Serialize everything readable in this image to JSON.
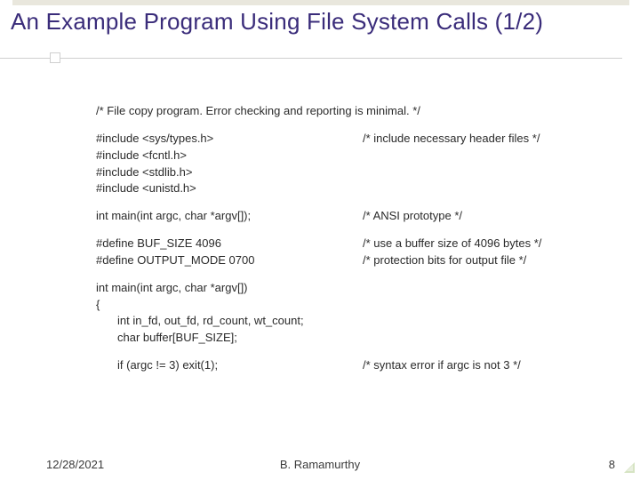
{
  "slide": {
    "title": "An Example Program Using File System Calls (1/2)"
  },
  "code": {
    "r0l": "/* File copy program. Error checking and reporting is minimal. */",
    "r1l": "#include <sys/types.h>",
    "r1r": "/* include necessary header files */",
    "r2l": "#include <fcntl.h>",
    "r3l": "#include <stdlib.h>",
    "r4l": "#include <unistd.h>",
    "r5l": "int main(int argc, char *argv[]);",
    "r5r": "/* ANSI prototype */",
    "r6l": "#define BUF_SIZE 4096",
    "r6r": "/* use a buffer size of 4096 bytes */",
    "r7l": "#define OUTPUT_MODE 0700",
    "r7r": "/* protection bits for output file */",
    "r8l": "int main(int argc, char *argv[])",
    "r9l": "{",
    "r10l": "int in_fd, out_fd, rd_count, wt_count;",
    "r11l": "char buffer[BUF_SIZE];",
    "r12l": "if (argc != 3) exit(1);",
    "r12r": "/* syntax error if argc is not 3 */"
  },
  "footer": {
    "date": "12/28/2021",
    "author": "B. Ramamurthy",
    "page": "8"
  }
}
